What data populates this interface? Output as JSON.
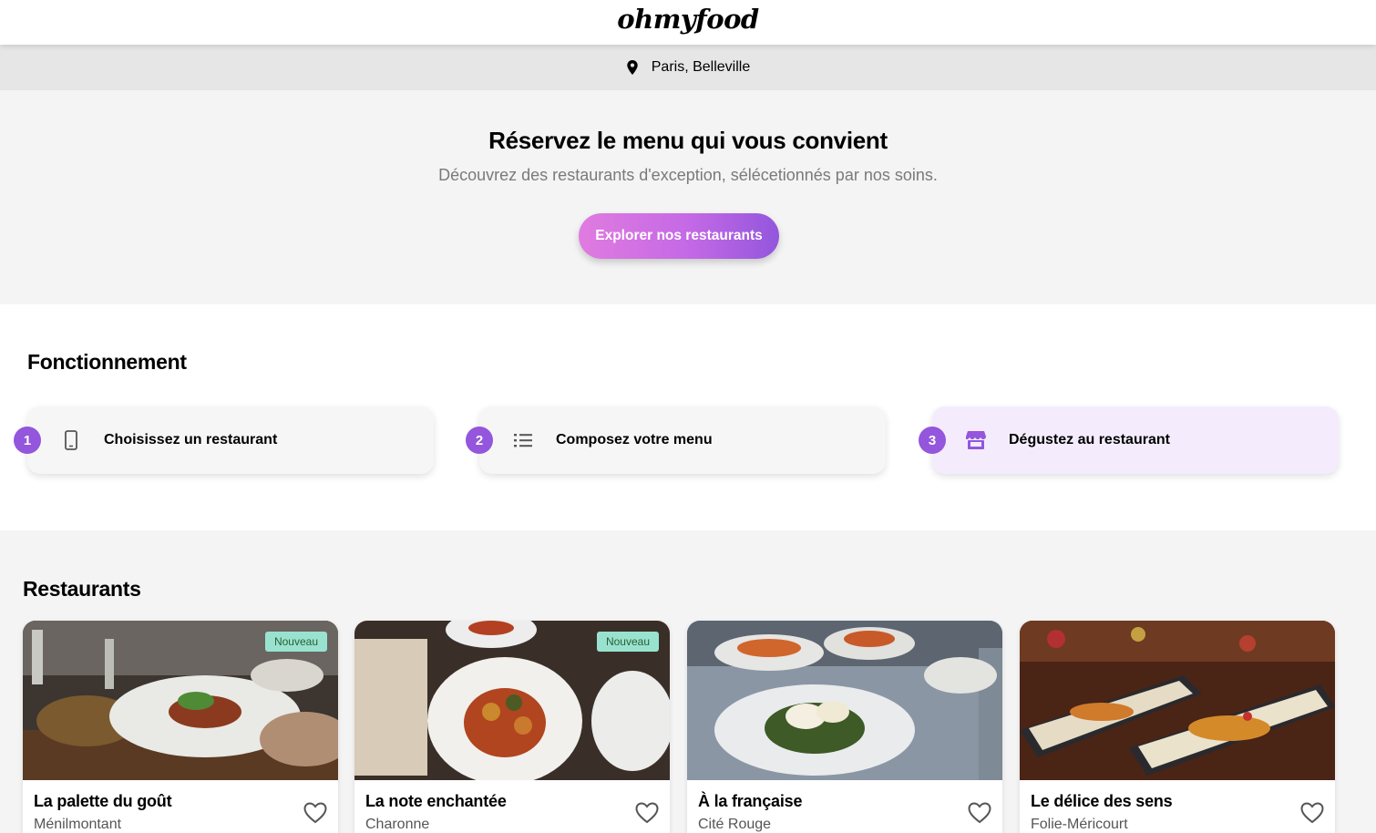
{
  "header": {
    "logo": "ohmyfood"
  },
  "location": {
    "icon": "map-pin-icon",
    "label": "Paris, Belleville"
  },
  "hero": {
    "title": "Réservez le menu qui vous convient",
    "subtitle": "Découvrez des restaurants d'exception, sélécetionnés par nos soins.",
    "cta_label": "Explorer nos restaurants"
  },
  "how": {
    "title": "Fonctionnement",
    "steps": [
      {
        "number": "1",
        "icon": "phone-icon",
        "label": "Choisissez un restaurant"
      },
      {
        "number": "2",
        "icon": "list-icon",
        "label": "Composez votre menu"
      },
      {
        "number": "3",
        "icon": "store-icon",
        "label": "Dégustez au restaurant"
      }
    ]
  },
  "restaurants": {
    "title": "Restaurants",
    "items": [
      {
        "name": "La palette du goût",
        "area": "Ménilmontant",
        "badge": "Nouveau"
      },
      {
        "name": "La note enchantée",
        "area": "Charonne",
        "badge": "Nouveau"
      },
      {
        "name": "À la française",
        "area": "Cité Rouge"
      },
      {
        "name": "Le délice des sens",
        "area": "Folie-Méricourt"
      }
    ]
  },
  "colors": {
    "accent": "#9356dc",
    "gradient_start": "#e07be0",
    "badge_bg": "#99e2d0"
  }
}
